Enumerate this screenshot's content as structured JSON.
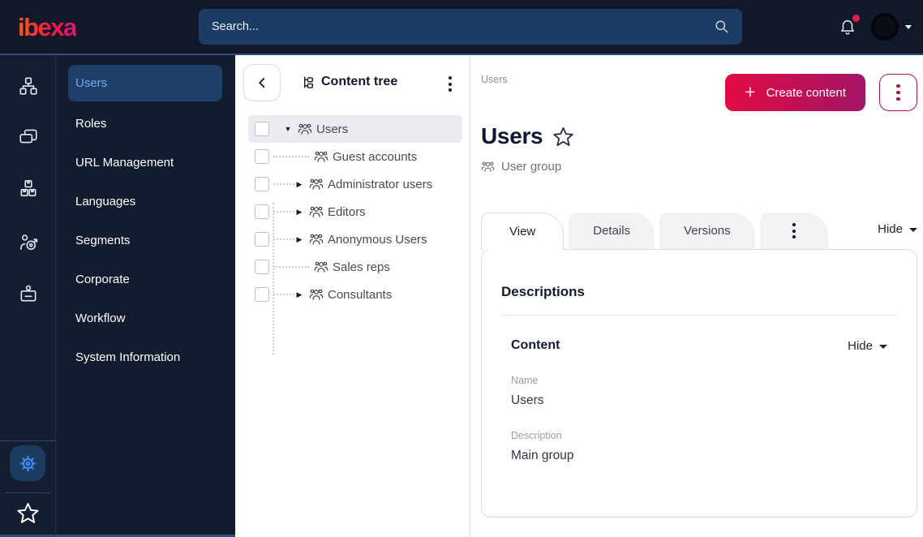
{
  "topbar": {
    "logo_text": "ibexa",
    "search_placeholder": "Search...",
    "has_notification": true
  },
  "nav_rail": {
    "icons": [
      "sitemap-icon",
      "content-pages-icon",
      "product-boxes-icon",
      "audience-target-icon",
      "badge-icon"
    ],
    "settings_icon": "gear-icon",
    "bookmarks_icon": "star-icon"
  },
  "sidebar": {
    "items": [
      {
        "label": "Users",
        "active": true
      },
      {
        "label": "Roles",
        "active": false
      },
      {
        "label": "URL Management",
        "active": false
      },
      {
        "label": "Languages",
        "active": false
      },
      {
        "label": "Segments",
        "active": false
      },
      {
        "label": "Corporate",
        "active": false
      },
      {
        "label": "Workflow",
        "active": false
      },
      {
        "label": "System Information",
        "active": false
      }
    ]
  },
  "content_tree": {
    "title": "Content tree",
    "items": [
      {
        "label": "Users",
        "state": "expanded",
        "selected": true
      },
      {
        "label": "Guest accounts",
        "state": "leaf",
        "selected": false
      },
      {
        "label": "Administrator users",
        "state": "collapsed",
        "selected": false
      },
      {
        "label": "Editors",
        "state": "collapsed",
        "selected": false
      },
      {
        "label": "Anonymous Users",
        "state": "collapsed",
        "selected": false
      },
      {
        "label": "Sales reps",
        "state": "leaf",
        "selected": false
      },
      {
        "label": "Consultants",
        "state": "collapsed",
        "selected": false
      }
    ]
  },
  "main": {
    "breadcrumb": "Users",
    "create_button_label": "Create content",
    "page_title": "Users",
    "content_type_label": "User group",
    "tabs": [
      {
        "label": "View",
        "active": true
      },
      {
        "label": "Details",
        "active": false
      },
      {
        "label": "Versions",
        "active": false
      }
    ],
    "hide_toggle_label": "Hide",
    "card": {
      "heading": "Descriptions",
      "section": {
        "title": "Content",
        "hide_toggle_label": "Hide",
        "fields": [
          {
            "label": "Name",
            "value": "Users"
          },
          {
            "label": "Description",
            "value": "Main group"
          }
        ]
      }
    }
  },
  "colors": {
    "topbar_bg": "#111829",
    "rail_bg": "#151d31",
    "sidebar_bg": "#131b2e",
    "topbar_underline": "#2b4d7f",
    "search_bg": "#1d3c64",
    "selected_item_bg": "#1f3f6a",
    "selected_item_text": "#74a9f2",
    "accent_blue": "#3e8df5",
    "button_gradient_start": "#e10b43",
    "button_gradient_end": "#a31566",
    "accent_crimson": "#a3145f",
    "tree_highlight": "#eaecf2",
    "notification_dot": "#e01f4b"
  }
}
